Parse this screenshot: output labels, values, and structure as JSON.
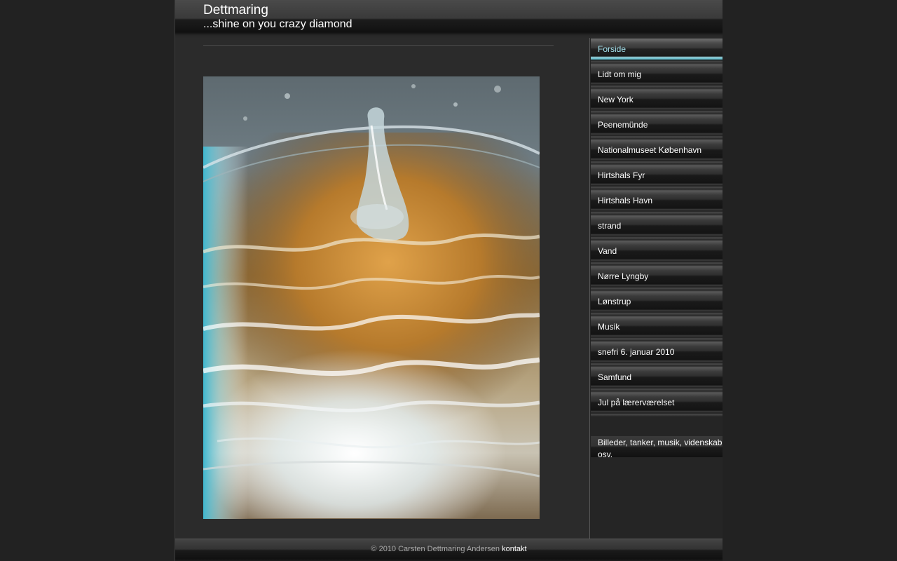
{
  "header": {
    "title": "Dettmaring",
    "subtitle": "...shine on you crazy diamond"
  },
  "content": {
    "photo_subject": "water-splash-in-glass"
  },
  "sidebar": {
    "items": [
      {
        "label": "Forside",
        "active": true
      },
      {
        "label": "Lidt om mig",
        "active": false
      },
      {
        "label": "New York",
        "active": false
      },
      {
        "label": "Peenemünde",
        "active": false
      },
      {
        "label": "Nationalmuseet København",
        "active": false
      },
      {
        "label": "Hirtshals Fyr",
        "active": false
      },
      {
        "label": "Hirtshals Havn",
        "active": false
      },
      {
        "label": "strand",
        "active": false
      },
      {
        "label": "Vand",
        "active": false
      },
      {
        "label": "Nørre Lyngby",
        "active": false
      },
      {
        "label": "Lønstrup",
        "active": false
      },
      {
        "label": "Musik",
        "active": false
      },
      {
        "label": "snefri 6. januar 2010",
        "active": false
      },
      {
        "label": "Samfund",
        "active": false
      },
      {
        "label": "Jul på lærerværelset",
        "active": false
      }
    ],
    "tagline": "Billeder, tanker, musik, videnskab osv."
  },
  "footer": {
    "copyright": "© 2010 Carsten Dettmaring Andersen",
    "contact_link": "kontakt"
  },
  "colors": {
    "background": "#222222",
    "page": "#2b2b2b",
    "active_nav": "#a6e4f0",
    "text": "#ffffff"
  }
}
